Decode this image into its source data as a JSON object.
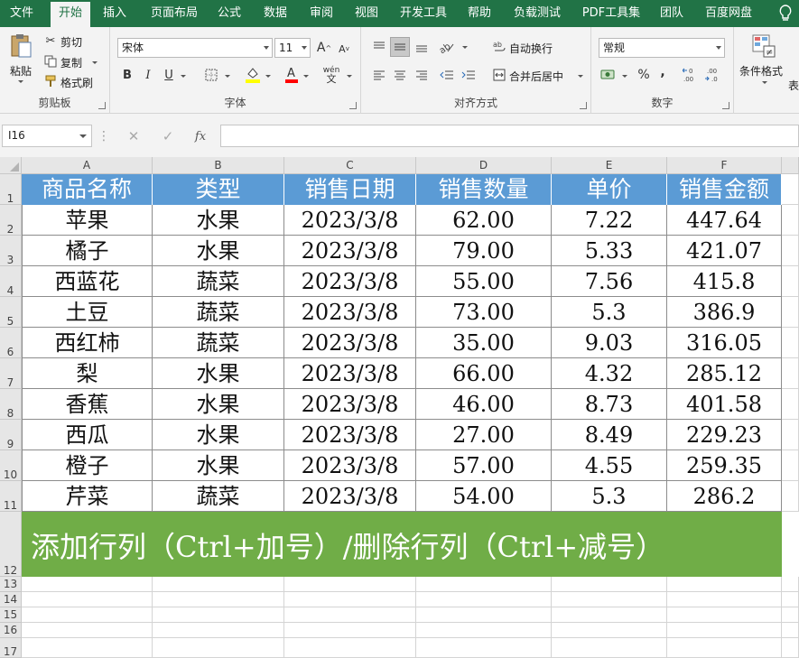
{
  "ribbon_tabs": [
    "文件",
    "开始",
    "插入",
    "页面布局",
    "公式",
    "数据",
    "审阅",
    "视图",
    "开发工具",
    "帮助",
    "负载测试",
    "PDF工具集",
    "团队",
    "百度网盘"
  ],
  "active_tab": "开始",
  "clipboard": {
    "paste": "粘贴",
    "cut": "剪切",
    "copy": "复制",
    "format_painter": "格式刷",
    "label": "剪贴板"
  },
  "font": {
    "name": "宋体",
    "size": "11",
    "grow": "A",
    "shrink": "A",
    "bold": "B",
    "italic": "I",
    "underline": "U",
    "label": "字体",
    "wen": "wén"
  },
  "alignment": {
    "wrap": "自动换行",
    "merge": "合并后居中",
    "label": "对齐方式"
  },
  "number": {
    "format": "常规",
    "percent": "%",
    "comma": ",",
    "label": "数字"
  },
  "styles": {
    "conditional": "条件格式",
    "table": "表"
  },
  "formula_bar": {
    "name_box": "I16",
    "fx": "fx",
    "value": ""
  },
  "columns": [
    "A",
    "B",
    "C",
    "D",
    "E",
    "F"
  ],
  "row_numbers": [
    "1",
    "2",
    "3",
    "4",
    "5",
    "6",
    "7",
    "8",
    "9",
    "10",
    "11",
    "12",
    "13",
    "14",
    "15",
    "16",
    "17"
  ],
  "table": {
    "headers": [
      "商品名称",
      "类型",
      "销售日期",
      "销售数量",
      "单价",
      "销售金额"
    ],
    "rows": [
      [
        "苹果",
        "水果",
        "2023/3/8",
        "62.00",
        "7.22",
        "447.64"
      ],
      [
        "橘子",
        "水果",
        "2023/3/8",
        "79.00",
        "5.33",
        "421.07"
      ],
      [
        "西蓝花",
        "蔬菜",
        "2023/3/8",
        "55.00",
        "7.56",
        "415.8"
      ],
      [
        "土豆",
        "蔬菜",
        "2023/3/8",
        "73.00",
        "5.3",
        "386.9"
      ],
      [
        "西红柿",
        "蔬菜",
        "2023/3/8",
        "35.00",
        "9.03",
        "316.05"
      ],
      [
        "梨",
        "水果",
        "2023/3/8",
        "66.00",
        "4.32",
        "285.12"
      ],
      [
        "香蕉",
        "水果",
        "2023/3/8",
        "46.00",
        "8.73",
        "401.58"
      ],
      [
        "西瓜",
        "水果",
        "2023/3/8",
        "27.00",
        "8.49",
        "229.23"
      ],
      [
        "橙子",
        "水果",
        "2023/3/8",
        "57.00",
        "4.55",
        "259.35"
      ],
      [
        "芹菜",
        "蔬菜",
        "2023/3/8",
        "54.00",
        "5.3",
        "286.2"
      ]
    ]
  },
  "banner_text": "添加行列（Ctrl+加号）/删除行列（Ctrl+减号）",
  "colors": {
    "ribbon": "#217346",
    "header_fill": "#5b9bd5",
    "banner_fill": "#70ad47"
  }
}
